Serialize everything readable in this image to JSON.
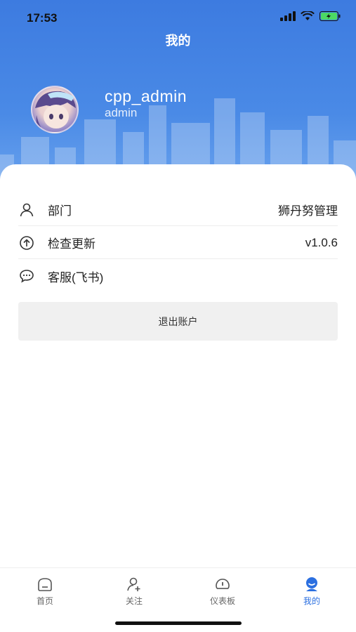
{
  "status_bar": {
    "time": "17:53"
  },
  "header": {
    "title": "我的"
  },
  "user": {
    "name": "cpp_admin",
    "role": "admin"
  },
  "menu": [
    {
      "icon": "user-icon",
      "label": "部门",
      "value": "狮丹努管理"
    },
    {
      "icon": "upload-icon",
      "label": "检查更新",
      "value": "v1.0.6"
    },
    {
      "icon": "chat-icon",
      "label": "客服(飞书)",
      "value": ""
    }
  ],
  "logout_label": "退出账户",
  "tabs": [
    {
      "icon": "home-icon",
      "label": "首页"
    },
    {
      "icon": "follow-icon",
      "label": "关注"
    },
    {
      "icon": "dashboard-icon",
      "label": "仪表板"
    },
    {
      "icon": "profile-icon",
      "label": "我的"
    }
  ],
  "colors": {
    "header_blue": "#3d7be0",
    "active_tab": "#2b6fe0",
    "logout_bg": "#f0f0f0"
  }
}
